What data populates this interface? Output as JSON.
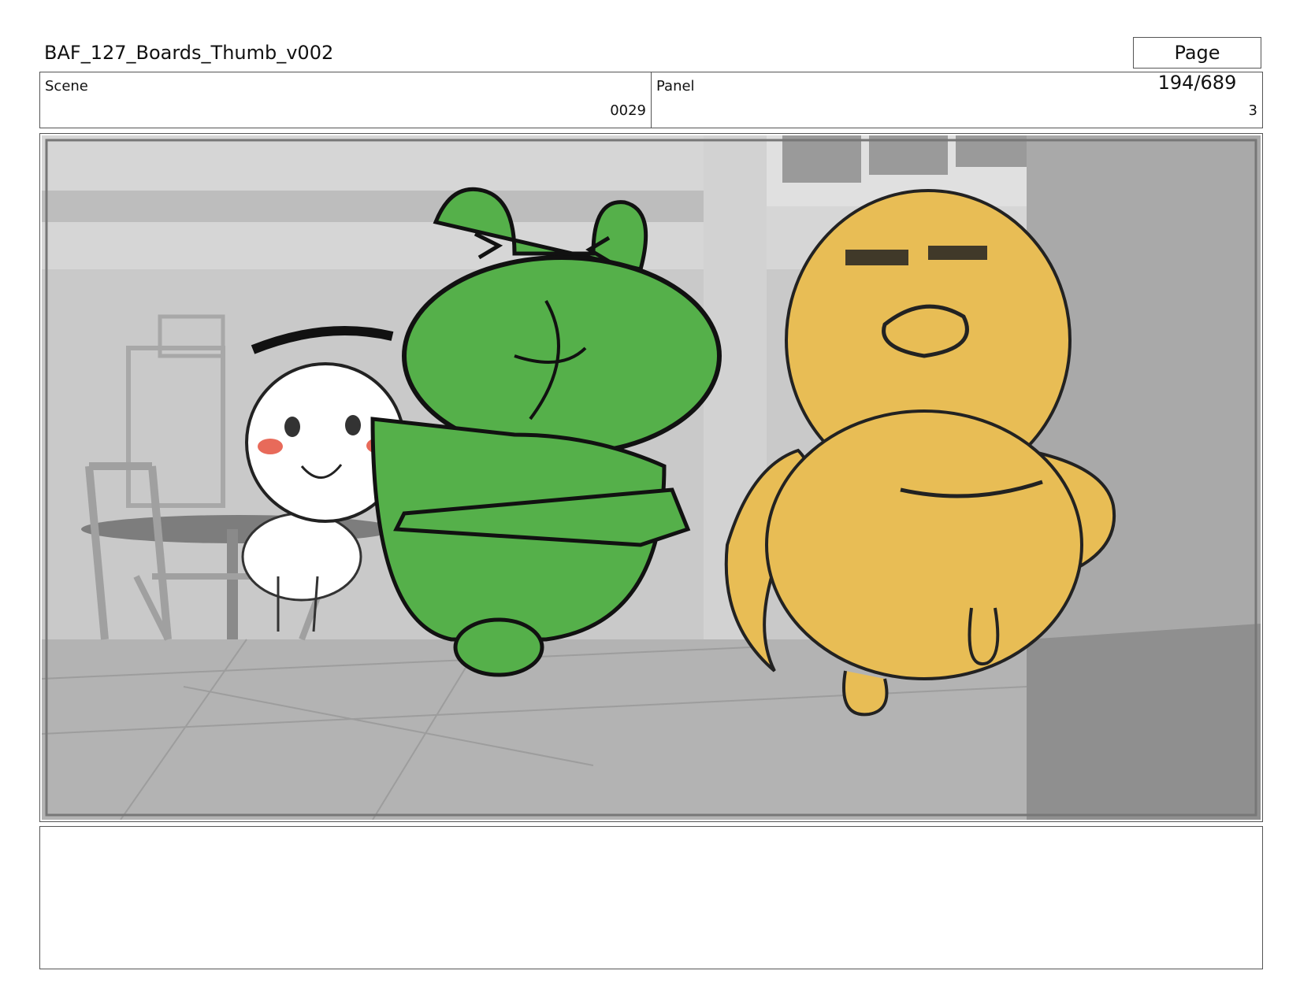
{
  "document": {
    "title": "BAF_127_Boards_Thumb_v002",
    "page": "Page 194/689"
  },
  "scene": {
    "label": "Scene",
    "value": "0029"
  },
  "panel": {
    "label": "Panel",
    "value": "3"
  },
  "artwork": {
    "characters": [
      "white-character",
      "green-character",
      "yellow-character"
    ],
    "colors": {
      "green": "#55b04a",
      "yellow": "#e8bd55",
      "background": "#c4c4c4",
      "blush": "#e86a5a"
    }
  },
  "notes": {
    "text": ""
  }
}
